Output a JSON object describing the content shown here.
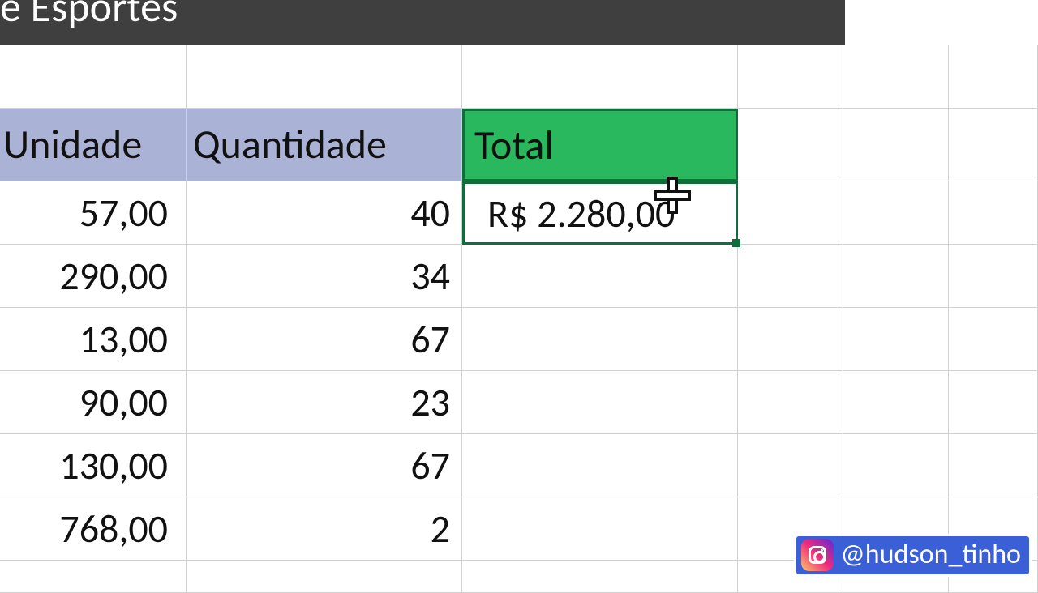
{
  "title_fragment": "e Esportes",
  "headers": {
    "unidade": "Unidade",
    "quantidade": "Quantidade",
    "total": "Total"
  },
  "rows": [
    {
      "unidade": "57,00",
      "quantidade": "40",
      "total": "R$ 2.280,00"
    },
    {
      "unidade": "290,00",
      "quantidade": "34",
      "total": ""
    },
    {
      "unidade": "13,00",
      "quantidade": "67",
      "total": ""
    },
    {
      "unidade": "90,00",
      "quantidade": "23",
      "total": ""
    },
    {
      "unidade": "130,00",
      "quantidade": "67",
      "total": ""
    },
    {
      "unidade": "768,00",
      "quantidade": "2",
      "total": ""
    }
  ],
  "instagram_handle": "@hudson_tinho",
  "colors": {
    "header_lilac": "#aab3d6",
    "header_green": "#2ab85e",
    "selection_border": "#0f6e3a",
    "title_bg": "#3f3f3f"
  }
}
